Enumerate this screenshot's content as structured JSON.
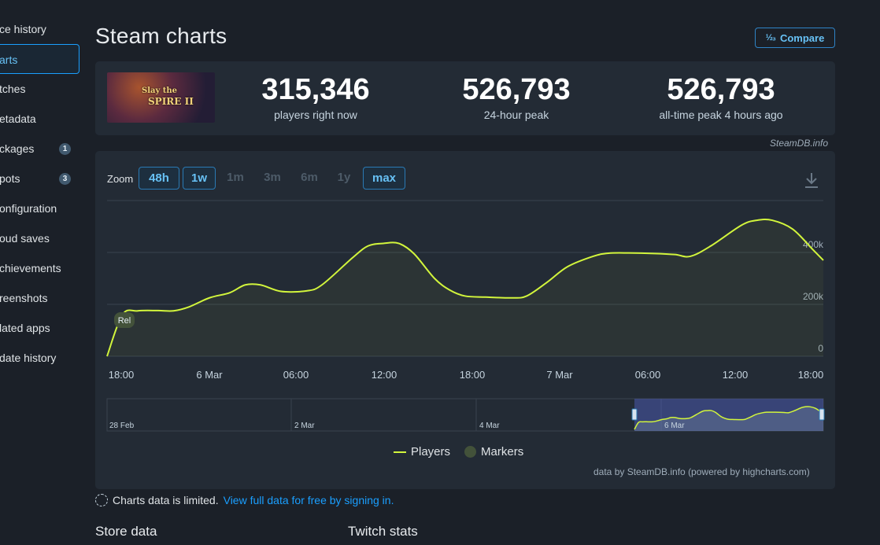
{
  "sidebar": {
    "items": [
      {
        "label": "ce history",
        "badge": null,
        "active": false
      },
      {
        "label": "arts",
        "badge": null,
        "active": true
      },
      {
        "label": "tches",
        "badge": null,
        "active": false
      },
      {
        "label": "etadata",
        "badge": null,
        "active": false
      },
      {
        "label": "ckages",
        "badge": "1",
        "active": false
      },
      {
        "label": "pots",
        "badge": "3",
        "active": false
      },
      {
        "label": "onfiguration",
        "badge": null,
        "active": false
      },
      {
        "label": "oud saves",
        "badge": null,
        "active": false
      },
      {
        "label": "chievements",
        "badge": null,
        "active": false
      },
      {
        "label": "reenshots",
        "badge": null,
        "active": false
      },
      {
        "label": "lated apps",
        "badge": null,
        "active": false
      },
      {
        "label": "date history",
        "badge": null,
        "active": false
      }
    ]
  },
  "header": {
    "title": "Steam charts",
    "compare_label": "Compare",
    "compare_icon": "½₃"
  },
  "game": {
    "logo_line1": "Slay the",
    "logo_line2": "SPIRE II"
  },
  "stats": [
    {
      "value": "315,346",
      "label": "players right now"
    },
    {
      "value": "526,793",
      "label": "24-hour peak"
    },
    {
      "value": "526,793",
      "label": "all-time peak 4 hours ago"
    }
  ],
  "credit": "SteamDB.info",
  "zoom": {
    "label": "Zoom",
    "options": [
      {
        "label": "48h",
        "active": true
      },
      {
        "label": "1w",
        "active": true
      },
      {
        "label": "1m",
        "active": false
      },
      {
        "label": "3m",
        "active": false
      },
      {
        "label": "6m",
        "active": false
      },
      {
        "label": "1y",
        "active": false
      },
      {
        "label": "max",
        "active": true
      }
    ]
  },
  "chart_data": {
    "type": "area",
    "series": [
      {
        "name": "Players",
        "color": "#d2f53c",
        "points": [
          [
            0,
            0
          ],
          [
            1.5,
            160000
          ],
          [
            3,
            175000
          ],
          [
            5,
            176000
          ],
          [
            6.5,
            175000
          ],
          [
            8,
            190000
          ],
          [
            10,
            225000
          ],
          [
            12,
            245000
          ],
          [
            13.5,
            275000
          ],
          [
            15,
            275000
          ],
          [
            17,
            250000
          ],
          [
            19.5,
            252000
          ],
          [
            21,
            275000
          ],
          [
            24,
            380000
          ],
          [
            25.5,
            425000
          ],
          [
            27,
            435000
          ],
          [
            28.5,
            435000
          ],
          [
            30,
            395000
          ],
          [
            32,
            300000
          ],
          [
            33.5,
            255000
          ],
          [
            35,
            232000
          ],
          [
            37,
            228000
          ],
          [
            39.5,
            225000
          ],
          [
            41,
            232000
          ],
          [
            43,
            285000
          ],
          [
            45,
            345000
          ],
          [
            47.5,
            385000
          ],
          [
            49,
            397000
          ],
          [
            51,
            398000
          ],
          [
            53.5,
            396000
          ],
          [
            55.5,
            392000
          ],
          [
            57,
            385000
          ],
          [
            59,
            425000
          ],
          [
            62,
            505000
          ],
          [
            63.5,
            524000
          ],
          [
            65,
            524000
          ],
          [
            67,
            490000
          ],
          [
            69,
            410000
          ],
          [
            70,
            370000
          ]
        ]
      }
    ],
    "markers": [
      {
        "label": "Rel",
        "x": 1
      }
    ],
    "x_tick_labels": [
      "18:00",
      "6 Mar",
      "06:00",
      "12:00",
      "18:00",
      "7 Mar",
      "06:00",
      "12:00",
      "18:00"
    ],
    "y_tick_labels": [
      "0",
      "200k",
      "400k"
    ],
    "ylim": [
      0,
      600000
    ],
    "navigator_labels": [
      "28 Feb",
      "2 Mar",
      "4 Mar",
      "6 Mar"
    ],
    "legend": [
      "Players",
      "Markers"
    ]
  },
  "powered_by": "data by SteamDB.info (powered by highcharts.com)",
  "notice": {
    "text": "Charts data is limited.",
    "link": "View full data for free by signing in."
  },
  "sections": [
    "Store data",
    "Twitch stats"
  ]
}
